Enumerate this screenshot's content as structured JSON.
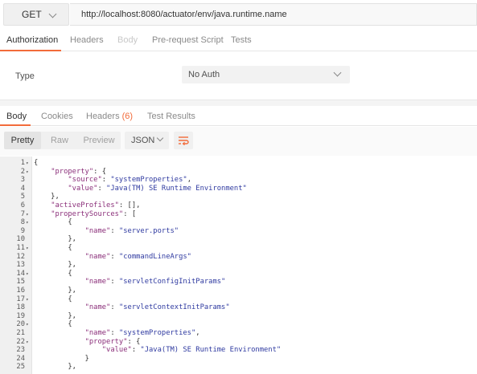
{
  "request": {
    "method": "GET",
    "url": "http://localhost:8080/actuator/env/java.runtime.name"
  },
  "request_tabs": [
    {
      "label": "Authorization",
      "state": "active"
    },
    {
      "label": "Headers",
      "state": "normal"
    },
    {
      "label": "Body",
      "state": "disabled"
    },
    {
      "label": "Pre-request Script",
      "state": "normal"
    },
    {
      "label": "Tests",
      "state": "normal"
    }
  ],
  "auth": {
    "type_label": "Type",
    "type_value": "No Auth"
  },
  "response_tabs": {
    "body": "Body",
    "cookies": "Cookies",
    "headers": "Headers",
    "headers_count": "(6)",
    "test_results": "Test Results"
  },
  "view_modes": [
    "Pretty",
    "Raw",
    "Preview"
  ],
  "format": "JSON",
  "icons": {
    "method_dropdown": "chevron-down-icon",
    "auth_dropdown": "chevron-down-icon",
    "format_dropdown": "chevron-down-icon",
    "wrap": "wrap-lines-icon"
  },
  "colors": {
    "accent": "#f26b3a",
    "json_key": "#8b2f7a",
    "json_string": "#2f3aa0"
  },
  "code_lines": [
    {
      "n": "1",
      "fold": true,
      "tokens": [
        {
          "t": "p",
          "v": "{"
        }
      ]
    },
    {
      "n": "2",
      "fold": true,
      "tokens": [
        {
          "t": "p",
          "v": "    "
        },
        {
          "t": "k",
          "v": "\"property\""
        },
        {
          "t": "p",
          "v": ": {"
        }
      ]
    },
    {
      "n": "3",
      "fold": false,
      "tokens": [
        {
          "t": "p",
          "v": "        "
        },
        {
          "t": "k",
          "v": "\"source\""
        },
        {
          "t": "p",
          "v": ": "
        },
        {
          "t": "s",
          "v": "\"systemProperties\""
        },
        {
          "t": "p",
          "v": ","
        }
      ]
    },
    {
      "n": "4",
      "fold": false,
      "tokens": [
        {
          "t": "p",
          "v": "        "
        },
        {
          "t": "k",
          "v": "\"value\""
        },
        {
          "t": "p",
          "v": ": "
        },
        {
          "t": "s",
          "v": "\"Java(TM) SE Runtime Environment\""
        }
      ]
    },
    {
      "n": "5",
      "fold": false,
      "tokens": [
        {
          "t": "p",
          "v": "    },"
        }
      ]
    },
    {
      "n": "6",
      "fold": false,
      "tokens": [
        {
          "t": "p",
          "v": "    "
        },
        {
          "t": "k",
          "v": "\"activeProfiles\""
        },
        {
          "t": "p",
          "v": ": [],"
        }
      ]
    },
    {
      "n": "7",
      "fold": true,
      "tokens": [
        {
          "t": "p",
          "v": "    "
        },
        {
          "t": "k",
          "v": "\"propertySources\""
        },
        {
          "t": "p",
          "v": ": ["
        }
      ]
    },
    {
      "n": "8",
      "fold": true,
      "tokens": [
        {
          "t": "p",
          "v": "        {"
        }
      ]
    },
    {
      "n": "9",
      "fold": false,
      "tokens": [
        {
          "t": "p",
          "v": "            "
        },
        {
          "t": "k",
          "v": "\"name\""
        },
        {
          "t": "p",
          "v": ": "
        },
        {
          "t": "s",
          "v": "\"server.ports\""
        }
      ]
    },
    {
      "n": "10",
      "fold": false,
      "tokens": [
        {
          "t": "p",
          "v": "        },"
        }
      ]
    },
    {
      "n": "11",
      "fold": true,
      "tokens": [
        {
          "t": "p",
          "v": "        {"
        }
      ]
    },
    {
      "n": "12",
      "fold": false,
      "tokens": [
        {
          "t": "p",
          "v": "            "
        },
        {
          "t": "k",
          "v": "\"name\""
        },
        {
          "t": "p",
          "v": ": "
        },
        {
          "t": "s",
          "v": "\"commandLineArgs\""
        }
      ]
    },
    {
      "n": "13",
      "fold": false,
      "tokens": [
        {
          "t": "p",
          "v": "        },"
        }
      ]
    },
    {
      "n": "14",
      "fold": true,
      "tokens": [
        {
          "t": "p",
          "v": "        {"
        }
      ]
    },
    {
      "n": "15",
      "fold": false,
      "tokens": [
        {
          "t": "p",
          "v": "            "
        },
        {
          "t": "k",
          "v": "\"name\""
        },
        {
          "t": "p",
          "v": ": "
        },
        {
          "t": "s",
          "v": "\"servletConfigInitParams\""
        }
      ]
    },
    {
      "n": "16",
      "fold": false,
      "tokens": [
        {
          "t": "p",
          "v": "        },"
        }
      ]
    },
    {
      "n": "17",
      "fold": true,
      "tokens": [
        {
          "t": "p",
          "v": "        {"
        }
      ]
    },
    {
      "n": "18",
      "fold": false,
      "tokens": [
        {
          "t": "p",
          "v": "            "
        },
        {
          "t": "k",
          "v": "\"name\""
        },
        {
          "t": "p",
          "v": ": "
        },
        {
          "t": "s",
          "v": "\"servletContextInitParams\""
        }
      ]
    },
    {
      "n": "19",
      "fold": false,
      "tokens": [
        {
          "t": "p",
          "v": "        },"
        }
      ]
    },
    {
      "n": "20",
      "fold": true,
      "tokens": [
        {
          "t": "p",
          "v": "        {"
        }
      ]
    },
    {
      "n": "21",
      "fold": false,
      "tokens": [
        {
          "t": "p",
          "v": "            "
        },
        {
          "t": "k",
          "v": "\"name\""
        },
        {
          "t": "p",
          "v": ": "
        },
        {
          "t": "s",
          "v": "\"systemProperties\""
        },
        {
          "t": "p",
          "v": ","
        }
      ]
    },
    {
      "n": "22",
      "fold": true,
      "tokens": [
        {
          "t": "p",
          "v": "            "
        },
        {
          "t": "k",
          "v": "\"property\""
        },
        {
          "t": "p",
          "v": ": {"
        }
      ]
    },
    {
      "n": "23",
      "fold": false,
      "tokens": [
        {
          "t": "p",
          "v": "                "
        },
        {
          "t": "k",
          "v": "\"value\""
        },
        {
          "t": "p",
          "v": ": "
        },
        {
          "t": "s",
          "v": "\"Java(TM) SE Runtime Environment\""
        }
      ]
    },
    {
      "n": "24",
      "fold": false,
      "tokens": [
        {
          "t": "p",
          "v": "            }"
        }
      ]
    },
    {
      "n": "25",
      "fold": false,
      "tokens": [
        {
          "t": "p",
          "v": "        },"
        }
      ]
    }
  ]
}
